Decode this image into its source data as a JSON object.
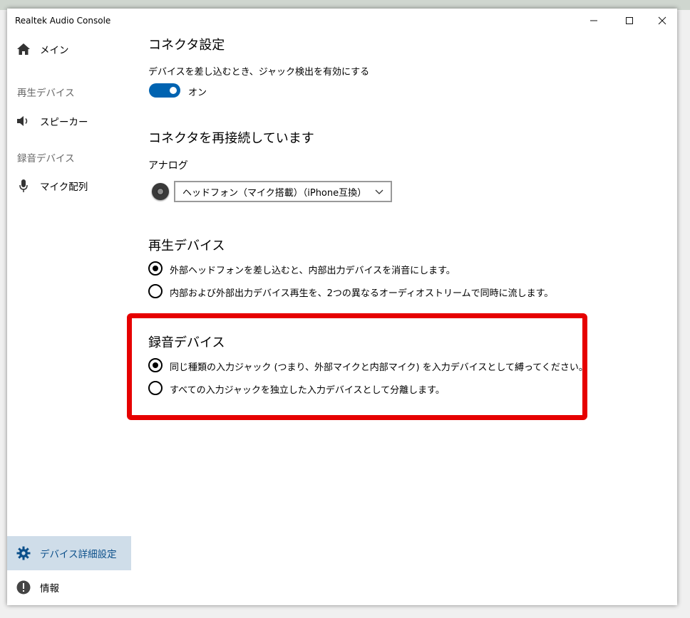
{
  "window": {
    "title": "Realtek Audio Console",
    "controls": [
      "minimize",
      "maximize",
      "close"
    ]
  },
  "sidebar": {
    "main_label": "メイン",
    "playback_section": "再生デバイス",
    "speaker_label": "スピーカー",
    "recording_section": "録音デバイス",
    "mic_label": "マイク配列",
    "advanced_label": "デバイス詳細設定",
    "info_label": "情報",
    "active_item": "デバイス詳細設定"
  },
  "connector": {
    "heading": "コネクタ設定",
    "jack_detect_label": "デバイスを差し込むとき、ジャック検出を有効にする",
    "toggle_state_label": "オン",
    "toggle_on": true
  },
  "reconnect": {
    "heading": "コネクタを再接続しています",
    "analog_label": "アナログ",
    "selected_device": "ヘッドフォン（マイク搭載）（iPhone互換）"
  },
  "playback": {
    "heading": "再生デバイス",
    "options": [
      {
        "label": "外部ヘッドフォンを差し込むと、内部出力デバイスを消音にします。",
        "checked": true
      },
      {
        "label": "内部および外部出力デバイス再生を、2つの異なるオーディオストリームで同時に流します。",
        "checked": false
      }
    ]
  },
  "recording": {
    "heading": "録音デバイス",
    "options": [
      {
        "label": "同じ種類の入力ジャック (つまり、外部マイクと内部マイク) を入力デバイスとして縛ってください。",
        "checked": true
      },
      {
        "label": "すべての入力ジャックを独立した入力デバイスとして分離します。",
        "checked": false
      }
    ]
  },
  "colors": {
    "accent": "#0063b1",
    "highlight_border": "#e60000",
    "active_nav_bg": "#cfdde9"
  }
}
